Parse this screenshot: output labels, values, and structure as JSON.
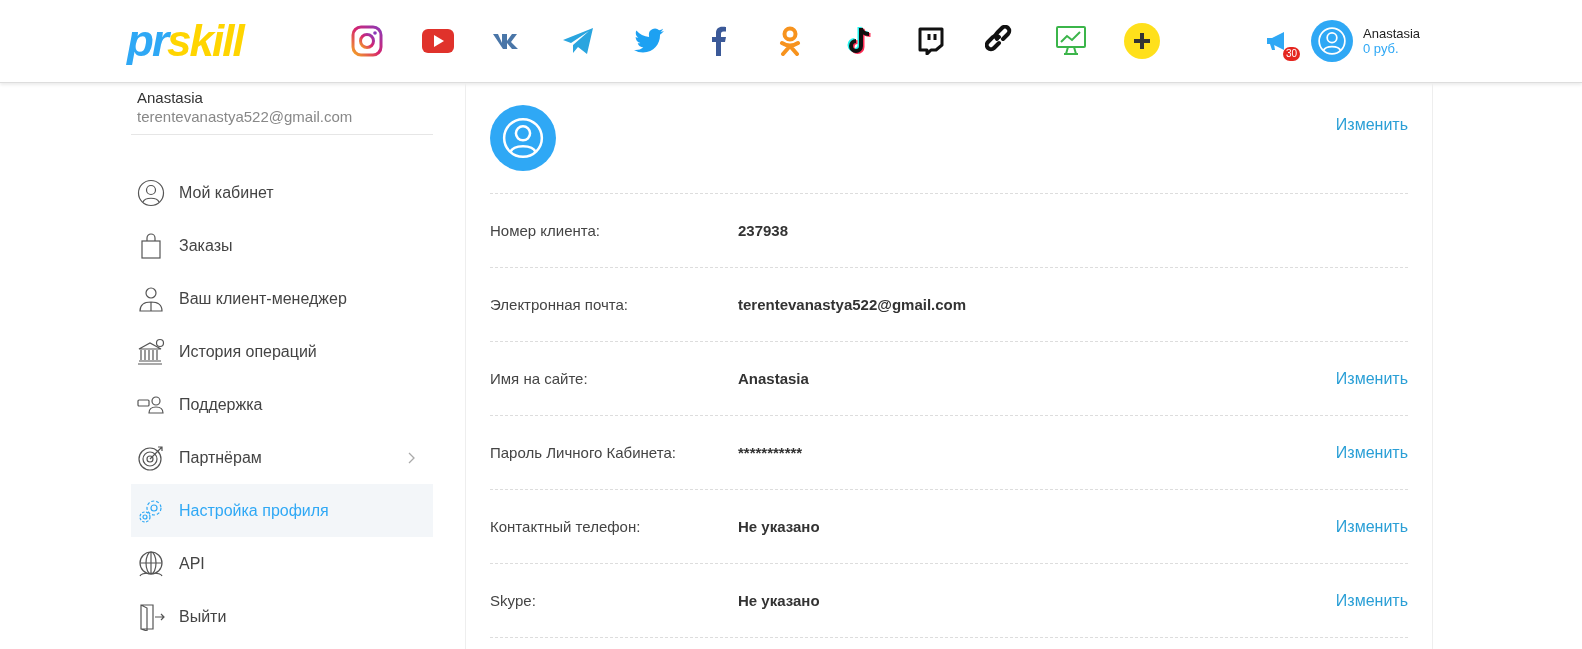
{
  "header": {
    "logo": {
      "part_a": "pr",
      "part_b": "skill"
    },
    "social": [
      {
        "kind": "instagram"
      },
      {
        "kind": "youtube"
      },
      {
        "kind": "vk"
      },
      {
        "kind": "telegram"
      },
      {
        "kind": "twitter"
      },
      {
        "kind": "facebook"
      },
      {
        "kind": "ok"
      },
      {
        "kind": "tiktok"
      },
      {
        "kind": "twitch"
      },
      {
        "kind": "link"
      },
      {
        "kind": "monitor"
      },
      {
        "kind": "plus"
      }
    ],
    "notifications": {
      "badge": "30"
    },
    "user": {
      "name": "Anastasia",
      "balance": "0 руб."
    }
  },
  "sidebar": {
    "name": "Anastasia",
    "email": "terentevanastya522@gmail.com",
    "items": [
      {
        "kind": "person",
        "label": "Мой кабинет",
        "selected": false,
        "has_submenu": false
      },
      {
        "kind": "bag",
        "label": "Заказы",
        "selected": false,
        "has_submenu": false
      },
      {
        "kind": "manager",
        "label": "Ваш клиент-менеджер",
        "selected": false,
        "has_submenu": false
      },
      {
        "kind": "bank",
        "label": "История операций",
        "selected": false,
        "has_submenu": false
      },
      {
        "kind": "support",
        "label": "Поддержка",
        "selected": false,
        "has_submenu": false
      },
      {
        "kind": "target",
        "label": "Партнёрам",
        "selected": false,
        "has_submenu": true
      },
      {
        "kind": "gear",
        "label": "Настройка профиля",
        "selected": true,
        "has_submenu": false
      },
      {
        "kind": "globe",
        "label": "API",
        "selected": false,
        "has_submenu": false
      },
      {
        "kind": "exit",
        "label": "Выйти",
        "selected": false,
        "has_submenu": false
      }
    ]
  },
  "profile": {
    "avatar_action": "Изменить",
    "rows": [
      {
        "label": "Номер клиента:",
        "value": "237938"
      },
      {
        "label": "Электронная почта:",
        "value": "terentevanastya522@gmail.com"
      },
      {
        "label": "Имя на сайте:",
        "value": "Anastasia",
        "action": "Изменить"
      },
      {
        "label": "Пароль Личного Кабинета:",
        "value": "***********",
        "action": "Изменить"
      },
      {
        "label": "Контактный телефон:",
        "value": "Не указано",
        "action": "Изменить"
      },
      {
        "label": "Skype:",
        "value": "Не указано",
        "action": "Изменить"
      }
    ]
  }
}
